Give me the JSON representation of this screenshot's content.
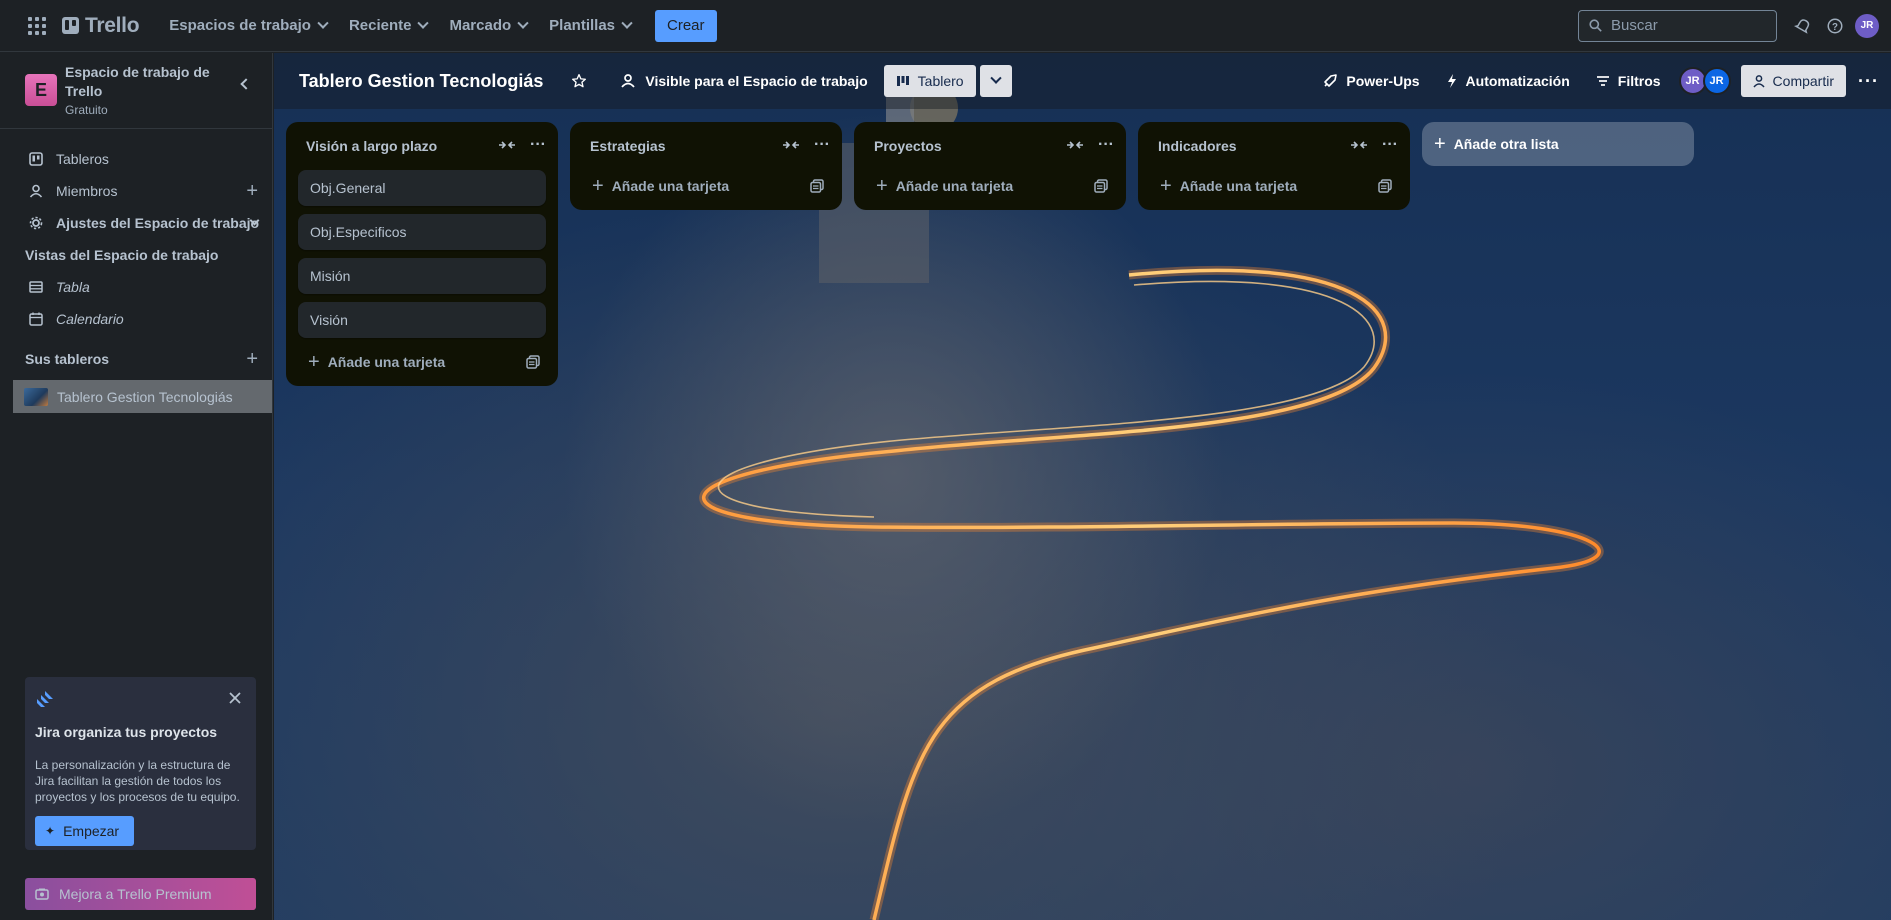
{
  "topnav": {
    "logo_text": "Trello",
    "menus": [
      "Espacios de trabajo",
      "Reciente",
      "Marcado",
      "Plantillas"
    ],
    "create_label": "Crear",
    "search_placeholder": "Buscar",
    "user_initials": "JR",
    "accent": "#579dff"
  },
  "sidebar": {
    "workspace_initial": "E",
    "workspace_name": "Espacio de trabajo de Trello",
    "workspace_plan": "Gratuito",
    "items": [
      {
        "label": "Tableros",
        "icon": "board-icon"
      },
      {
        "label": "Miembros",
        "icon": "person-icon"
      },
      {
        "label": "Ajustes del Espacio de trabajo",
        "icon": "gear-icon"
      }
    ],
    "views_heading": "Vistas del Espacio de trabajo",
    "views": [
      {
        "label": "Tabla",
        "icon": "table-icon"
      },
      {
        "label": "Calendario",
        "icon": "calendar-icon"
      }
    ],
    "boards_heading": "Sus tableros",
    "boards": [
      {
        "label": "Tablero Gestion Tecnologiás"
      }
    ],
    "jira_promo": {
      "title": "Jira organiza tus proyectos",
      "text": "La personalización y la estructura de Jira facilitan la gestión de todos los proyectos y los procesos de tu equipo.",
      "button": "Empezar"
    },
    "premium_label": "Mejora a Trello Premium"
  },
  "board": {
    "title": "Tablero Gestion Tecnologiás",
    "visibility": "Visible para el Espacio de trabajo",
    "view_label": "Tablero",
    "powerups": "Power-Ups",
    "automation": "Automatización",
    "filters": "Filtros",
    "members": [
      {
        "initials": "JR",
        "color": "#6e5dc6"
      },
      {
        "initials": "JR",
        "color": "#0c66e4"
      }
    ],
    "share_label": "Compartir",
    "lists": [
      {
        "title": "Visión a largo plazo",
        "cards": [
          "Obj.General",
          "Obj.Especificos",
          "Misión",
          "Visión"
        ],
        "add_label": "Añade una tarjeta"
      },
      {
        "title": "Estrategias",
        "cards": [],
        "add_label": "Añade una tarjeta"
      },
      {
        "title": "Proyectos",
        "cards": [],
        "add_label": "Añade una tarjeta"
      },
      {
        "title": "Indicadores",
        "cards": [],
        "add_label": "Añade una tarjeta"
      }
    ],
    "add_list_label": "Añade otra lista"
  }
}
